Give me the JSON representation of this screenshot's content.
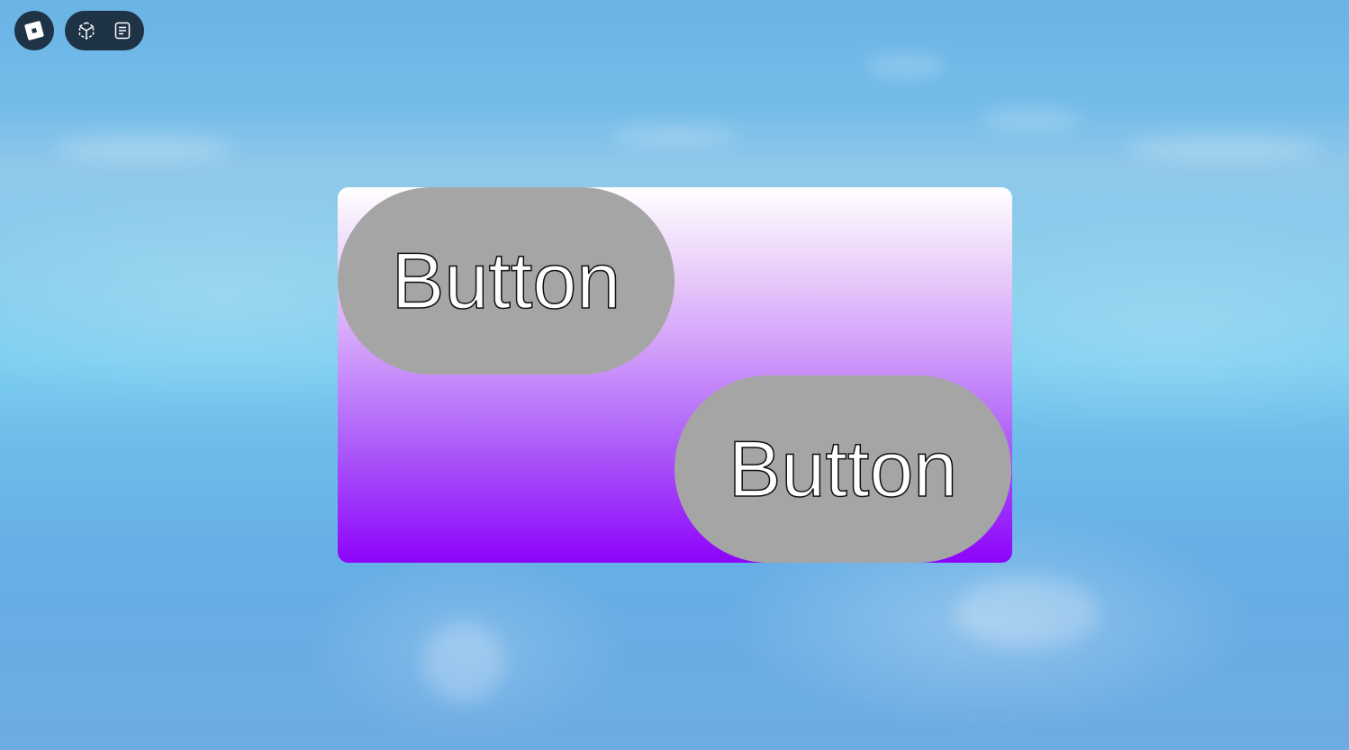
{
  "hud": {
    "home_icon": "roblox-logo-icon",
    "icons": [
      "capture-icon",
      "chat-icon"
    ]
  },
  "frame": {
    "gradient_colors": [
      "#ffffff",
      "#8d04fb"
    ],
    "buttons": [
      {
        "label": "Button",
        "color": "#a6a5a6"
      },
      {
        "label": "Button",
        "color": "#a6a5a6"
      }
    ]
  }
}
